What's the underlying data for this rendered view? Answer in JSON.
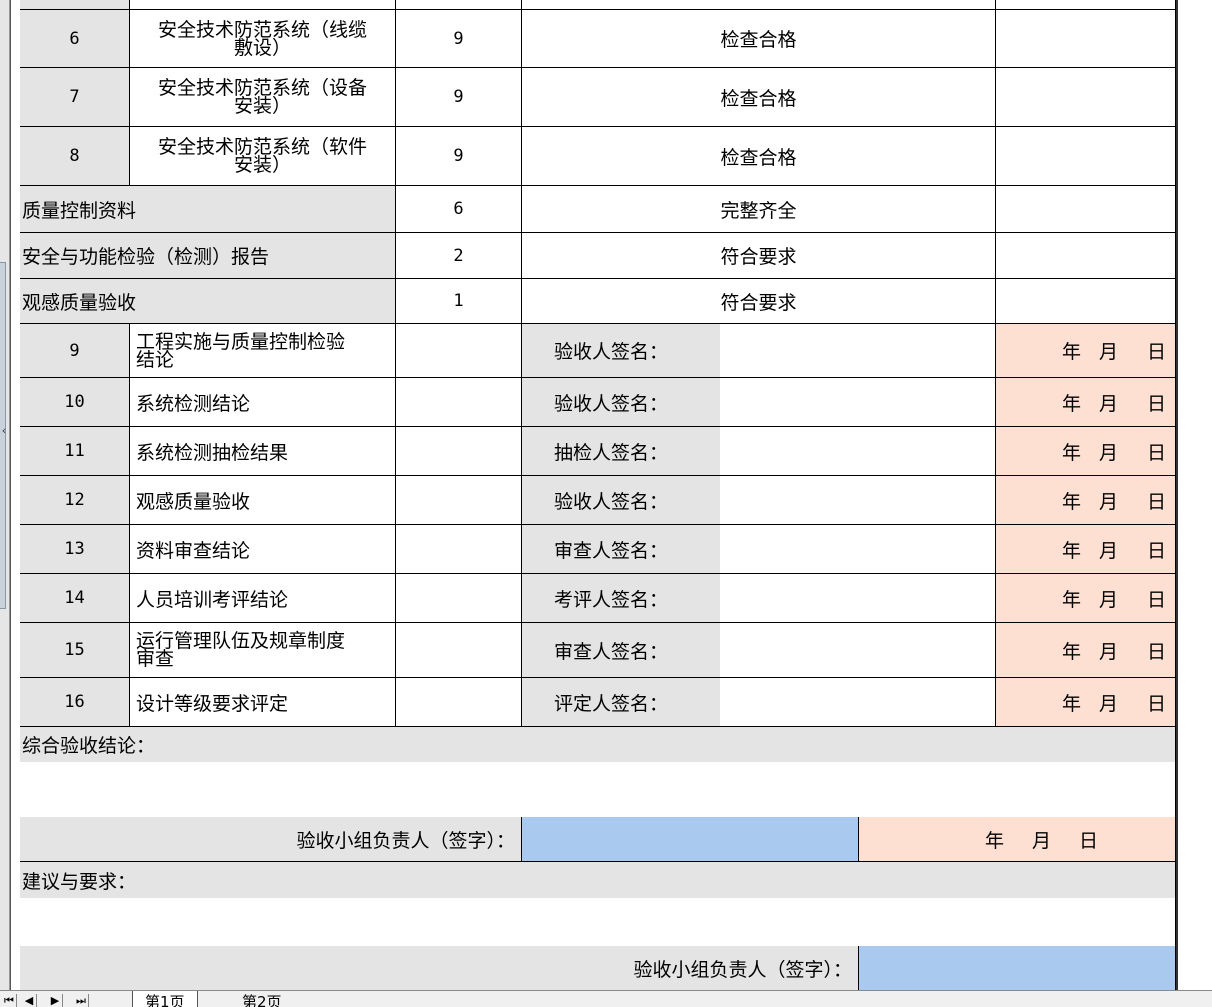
{
  "rows_top": [
    {
      "no": "6",
      "item": "安全技术防范系统（线缆",
      "item2": "敷设）",
      "score": "9",
      "result": "检查合格"
    },
    {
      "no": "7",
      "item": "安全技术防范系统（设备",
      "item2": "安装）",
      "score": "9",
      "result": "检查合格"
    },
    {
      "no": "8",
      "item": "安全技术防范系统（软件",
      "item2": "安装）",
      "score": "9",
      "result": "检查合格"
    }
  ],
  "rows_mid": [
    {
      "item": "质量控制资料",
      "score": "6",
      "result": "完整齐全"
    },
    {
      "item": "安全与功能检验（检测）报告",
      "score": "2",
      "result": "符合要求"
    },
    {
      "item": "观感质量验收",
      "score": "1",
      "result": "符合要求"
    }
  ],
  "rows_sign": [
    {
      "no": "9",
      "item": "工程实施与质量控制检验",
      "item2": "结论",
      "sign": "验收人签名："
    },
    {
      "no": "10",
      "item": "系统检测结论",
      "item2": "",
      "sign": "验收人签名："
    },
    {
      "no": "11",
      "item": "系统检测抽检结果",
      "item2": "",
      "sign": "抽检人签名："
    },
    {
      "no": "12",
      "item": "观感质量验收",
      "item2": "",
      "sign": "验收人签名："
    },
    {
      "no": "13",
      "item": "资料审查结论",
      "item2": "",
      "sign": "审查人签名："
    },
    {
      "no": "14",
      "item": "人员培训考评结论",
      "item2": "",
      "sign": "考评人签名："
    },
    {
      "no": "15",
      "item": "运行管理队伍及规章制度",
      "item2": "审查",
      "sign": "审查人签名："
    },
    {
      "no": "16",
      "item": "设计等级要求评定",
      "item2": "",
      "sign": "评定人签名："
    }
  ],
  "date": {
    "year": "年",
    "month": "月",
    "day": "日"
  },
  "conclusion": {
    "label": "综合验收结论：",
    "leader_label": "验收小组负责人（签字）："
  },
  "suggestion": {
    "label": "建议与要求：",
    "leader_label": "验收小组负责人（签字）："
  },
  "tabbar": {
    "nav": [
      "⏮",
      "◀",
      "▶",
      "⏭"
    ],
    "tabs": [
      "第1页",
      "第2页"
    ]
  },
  "colors": {
    "gray": "#e4e4e4",
    "peach": "#fde0d2",
    "blue": "#a9c9ee"
  }
}
